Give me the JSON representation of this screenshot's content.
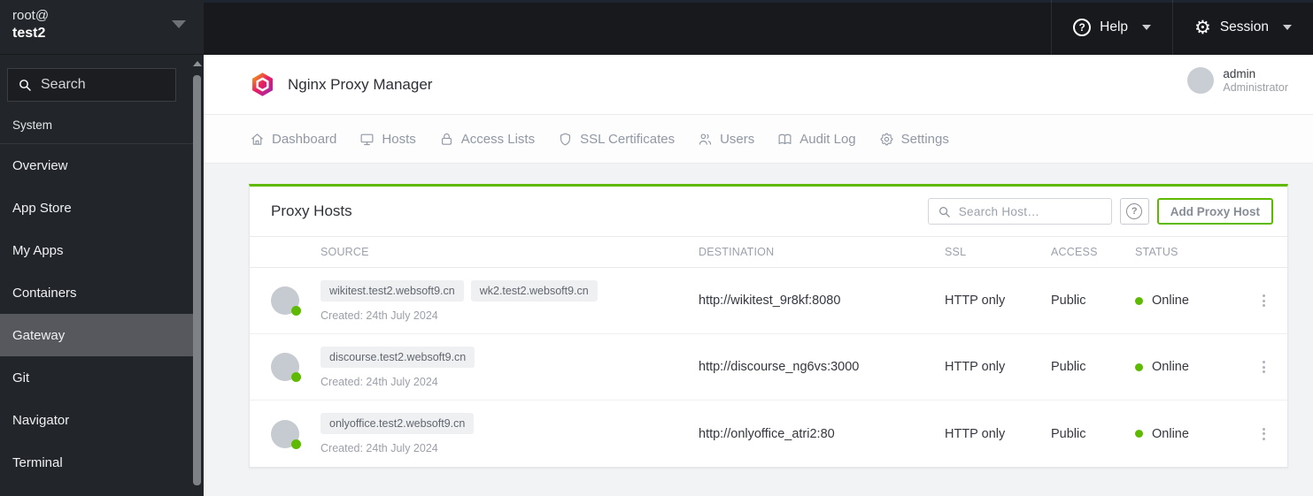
{
  "colors": {
    "accent_green": "#5eba00",
    "status_online": "#5eba00"
  },
  "topbar": {
    "help_label": "Help",
    "session_label": "Session"
  },
  "sidebar": {
    "user_line1": "root@",
    "user_line2": "test2",
    "search_placeholder": "Search",
    "section_label": "System",
    "items": [
      {
        "label": "Overview",
        "active": false
      },
      {
        "label": "App Store",
        "active": false
      },
      {
        "label": "My Apps",
        "active": false
      },
      {
        "label": "Containers",
        "active": false
      },
      {
        "label": "Gateway",
        "active": true
      },
      {
        "label": "Git",
        "active": false
      },
      {
        "label": "Navigator",
        "active": false
      },
      {
        "label": "Terminal",
        "active": false
      }
    ]
  },
  "header": {
    "app_title": "Nginx Proxy Manager",
    "user_name": "admin",
    "user_role": "Administrator"
  },
  "nav": {
    "tabs": [
      {
        "label": "Dashboard",
        "icon": "home"
      },
      {
        "label": "Hosts",
        "icon": "monitor"
      },
      {
        "label": "Access Lists",
        "icon": "lock"
      },
      {
        "label": "SSL Certificates",
        "icon": "shield"
      },
      {
        "label": "Users",
        "icon": "users"
      },
      {
        "label": "Audit Log",
        "icon": "book"
      },
      {
        "label": "Settings",
        "icon": "gear"
      }
    ]
  },
  "panel": {
    "title": "Proxy Hosts",
    "search_placeholder": "Search Host…",
    "help_button": "?",
    "add_button_label": "Add Proxy Host",
    "table": {
      "columns": [
        "SOURCE",
        "DESTINATION",
        "SSL",
        "ACCESS",
        "STATUS"
      ],
      "rows": [
        {
          "sources": [
            "wikitest.test2.websoft9.cn",
            "wk2.test2.websoft9.cn"
          ],
          "created": "Created: 24th July 2024",
          "destination": "http://wikitest_9r8kf:8080",
          "ssl": "HTTP only",
          "access": "Public",
          "status": "Online"
        },
        {
          "sources": [
            "discourse.test2.websoft9.cn"
          ],
          "created": "Created: 24th July 2024",
          "destination": "http://discourse_ng6vs:3000",
          "ssl": "HTTP only",
          "access": "Public",
          "status": "Online"
        },
        {
          "sources": [
            "onlyoffice.test2.websoft9.cn"
          ],
          "created": "Created: 24th July 2024",
          "destination": "http://onlyoffice_atri2:80",
          "ssl": "HTTP only",
          "access": "Public",
          "status": "Online"
        }
      ]
    }
  }
}
